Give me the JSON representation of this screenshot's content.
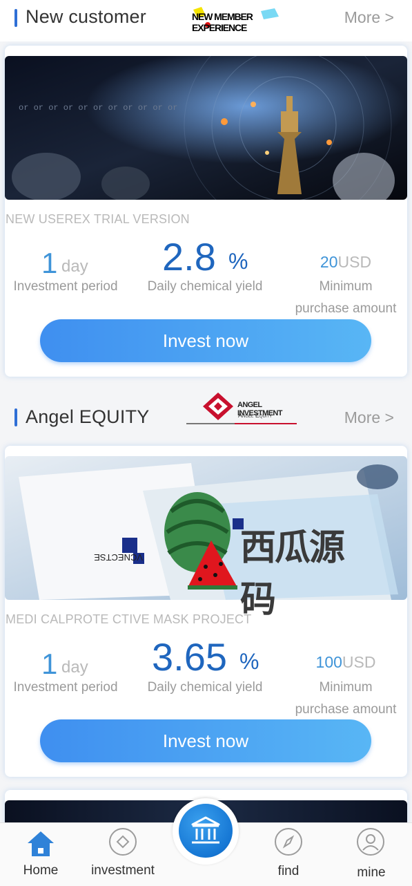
{
  "sections": [
    {
      "title": "New customer",
      "more_label": "More >",
      "logo_text": "NEW MEMBER EXPERIENCE",
      "product": {
        "name": "NEW USEREX TRIAL VERSION",
        "period_value": "1",
        "period_unit": "day",
        "period_label": "Investment period",
        "yield_value": "2.8",
        "yield_unit": "%",
        "yield_label": "Daily chemical yield",
        "min_value": "20",
        "min_unit": "USD",
        "min_label_line1": "Minimum",
        "min_label_line2": "purchase amount",
        "button_label": "Invest now"
      }
    },
    {
      "title": "Angel EQUITY",
      "more_label": "More >",
      "logo_text_1": "ANGEL INVESTMENT",
      "logo_text_2": "Angel Equity",
      "watermark_text": "西瓜源码",
      "product": {
        "name": "MEDI CALPROTE CTIVE MASK PROJECT",
        "period_value": "1",
        "period_unit": "day",
        "period_label": "Investment period",
        "yield_value": "3.65",
        "yield_unit": "%",
        "yield_label": "Daily chemical yield",
        "min_value": "100",
        "min_unit": "USD",
        "min_label_line1": "Minimum",
        "min_label_line2": "purchase amount",
        "button_label": "Invest now"
      }
    }
  ],
  "tabbar": {
    "items": [
      {
        "label": "Home",
        "icon": "home-icon",
        "active": true
      },
      {
        "label": "investment",
        "icon": "diamond-icon"
      },
      {
        "label": "",
        "icon": "bank-icon"
      },
      {
        "label": "find",
        "icon": "compass-icon"
      },
      {
        "label": "mine",
        "icon": "user-icon"
      }
    ]
  },
  "colors": {
    "accent": "#2f6fd6",
    "button_gradient_start": "#3f8ff0",
    "button_gradient_end": "#58b6f5",
    "yield": "#1f66be",
    "period": "#3f94d8"
  }
}
